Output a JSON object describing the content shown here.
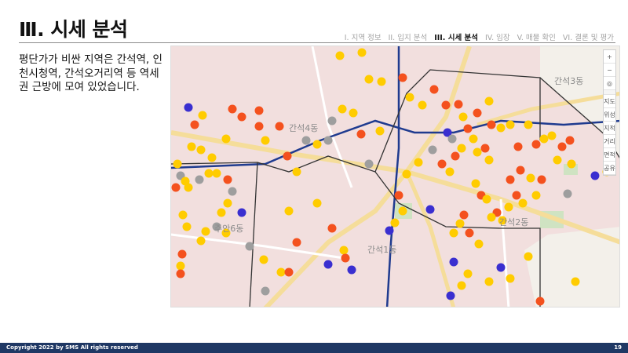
{
  "title": "Ⅲ. 시세 분석",
  "nav": [
    {
      "label": "I. 지역 정보",
      "active": false
    },
    {
      "label": "II. 입지 분석",
      "active": false
    },
    {
      "label": "III. 시세 분석",
      "active": true
    },
    {
      "label": "IV. 임장",
      "active": false
    },
    {
      "label": "V. 매물 확인",
      "active": false
    },
    {
      "label": "VI. 결론 및 평가",
      "active": false
    }
  ],
  "description": "평단가가 비싼 지역은 간석역, 인천시청역, 간석오거리역 등 역세권 근방에 모여 있었습니다.",
  "map": {
    "area_labels": [
      "간석4동",
      "간석3동",
      "주안6동",
      "간석1동",
      "간석2동"
    ],
    "controls": [
      "+",
      "−",
      "◎",
      "지도",
      "위성",
      "지적",
      "거리",
      "면적",
      "공유"
    ],
    "colors": {
      "price_high": "#f4511e",
      "price_mid": "#ffcc00",
      "price_low": "#9e9e9e",
      "price_top": "#3a2fd0",
      "area_fill": "#f2dada",
      "boundary": "#333333",
      "rail": "#1f3b8f",
      "road": "#f5dd9a"
    }
  },
  "footer": {
    "copyright": "Copyright 2022 by SMS All rights reserved",
    "page": "19"
  }
}
